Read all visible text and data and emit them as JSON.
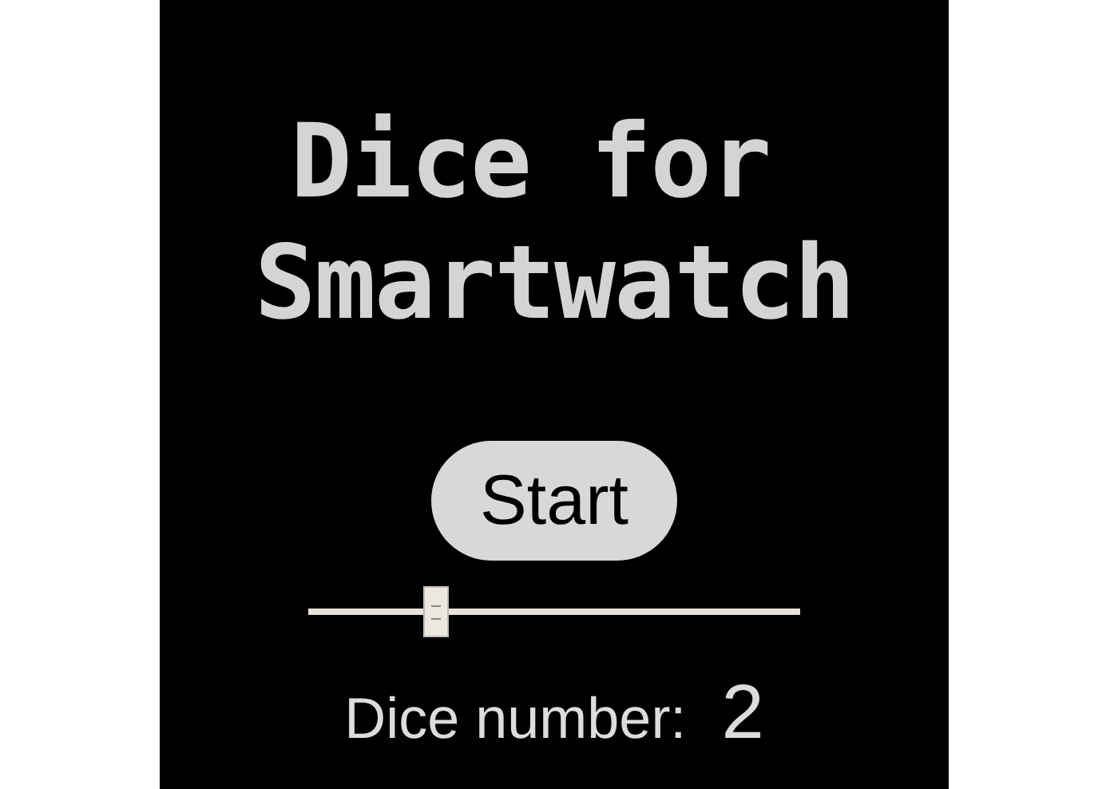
{
  "title": [
    "Dice for",
    "Smartwatch"
  ],
  "start_button": {
    "label": "Start"
  },
  "dice_slider": {
    "level": 0.26
  },
  "dice_count": {
    "label": "Dice number:",
    "value": "2"
  }
}
